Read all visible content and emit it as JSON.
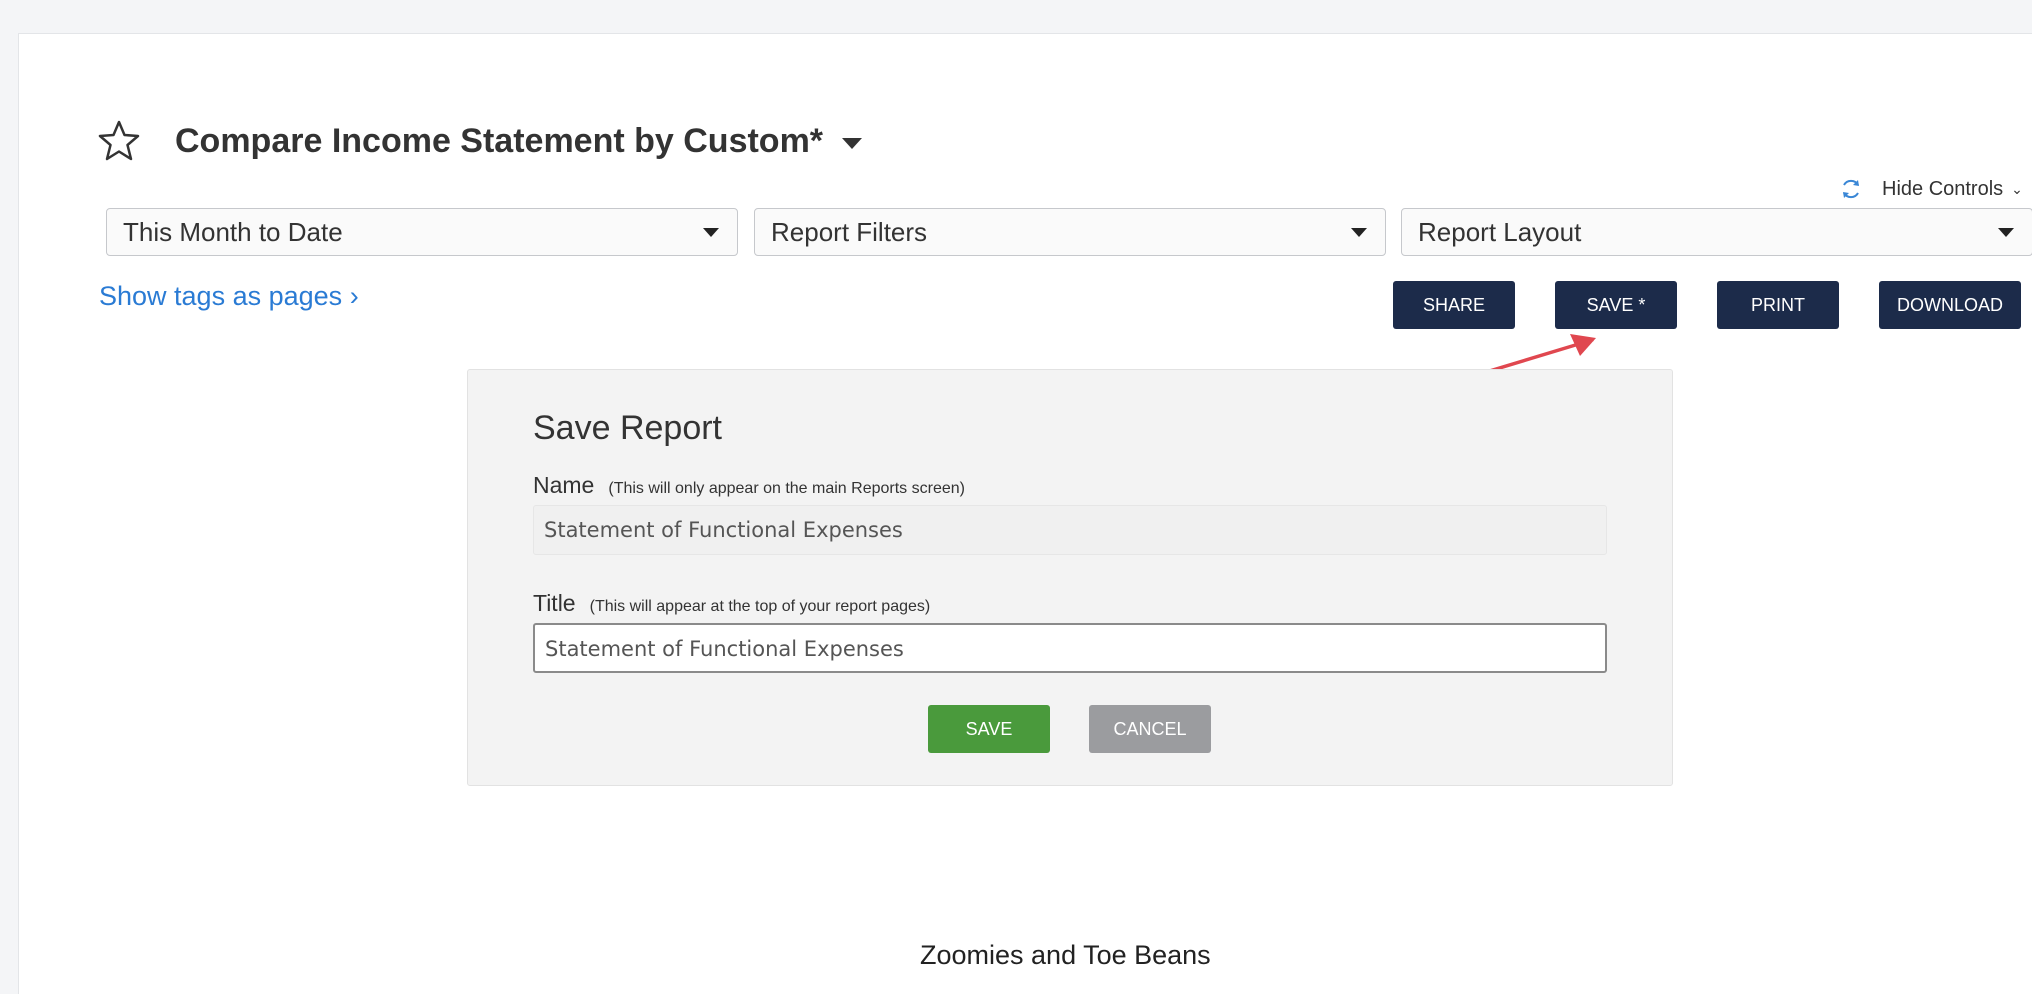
{
  "report": {
    "title": "Compare Income Statement by Custom*",
    "hide_controls": "Hide Controls",
    "show_tags": "Show tags as pages",
    "show_tags_chevron": "›",
    "company_name": "Zoomies and Toe Beans"
  },
  "filters": {
    "date_range": "This Month to Date",
    "report_filters": "Report Filters",
    "report_layout": "Report Layout"
  },
  "toolbar": {
    "share": "SHARE",
    "save": "SAVE *",
    "print": "PRINT",
    "download": "DOWNLOAD"
  },
  "save_dialog": {
    "heading": "Save Report",
    "name_label": "Name",
    "name_hint": "(This will only appear on the main Reports screen)",
    "name_value": "Statement of Functional Expenses",
    "title_label": "Title",
    "title_hint": "(This will appear at the top of your report pages)",
    "title_value": "Statement of Functional Expenses",
    "save_label": "SAVE",
    "cancel_label": "CANCEL"
  },
  "colors": {
    "navy": "#1c2b4a",
    "green": "#4a9a3c",
    "link": "#2a7bd4",
    "annotation_arrow": "#e0474f"
  },
  "icons": {
    "favorite": "star-outline-icon",
    "refresh": "refresh-icon",
    "dropdown": "caret-down-icon"
  }
}
